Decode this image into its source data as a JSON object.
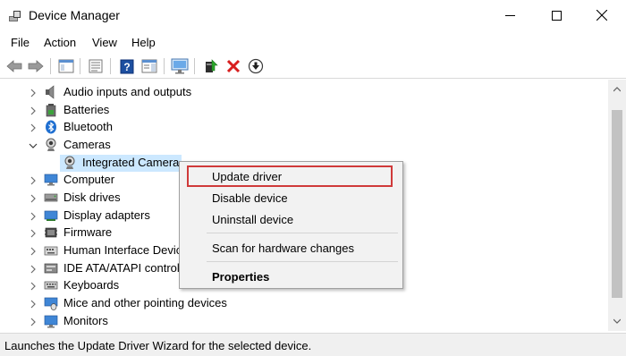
{
  "window": {
    "title": "Device Manager",
    "icon": "device-manager-icon",
    "controls": [
      "minimize-icon",
      "maximize-icon",
      "close-icon"
    ]
  },
  "menu": {
    "items": [
      {
        "label": "File"
      },
      {
        "label": "Action"
      },
      {
        "label": "View"
      },
      {
        "label": "Help"
      }
    ]
  },
  "toolbar": {
    "buttons": [
      {
        "icon": "back-arrow-icon"
      },
      {
        "icon": "forward-arrow-icon"
      },
      {
        "icon": "show-hide-console-tree-icon"
      },
      {
        "icon": "properties-icon"
      },
      {
        "icon": "help-icon"
      },
      {
        "icon": "action-pane-icon"
      },
      {
        "icon": "scan-hardware-icon"
      },
      {
        "icon": "update-driver-icon"
      },
      {
        "icon": "uninstall-icon"
      },
      {
        "icon": "disable-device-icon"
      }
    ]
  },
  "tree": {
    "items": [
      {
        "label": "Audio inputs and outputs",
        "icon": "speaker-icon",
        "expanded": false
      },
      {
        "label": "Batteries",
        "icon": "battery-icon",
        "expanded": false
      },
      {
        "label": "Bluetooth",
        "icon": "bluetooth-icon",
        "expanded": false
      },
      {
        "label": "Cameras",
        "icon": "camera-icon",
        "expanded": true
      },
      {
        "label": "Integrated Camera",
        "icon": "webcam-icon",
        "selected": true
      },
      {
        "label": "Computer",
        "icon": "computer-icon",
        "expanded": false
      },
      {
        "label": "Disk drives",
        "icon": "disk-drive-icon",
        "expanded": false
      },
      {
        "label": "Display adapters",
        "icon": "display-adapter-icon",
        "expanded": false
      },
      {
        "label": "Firmware",
        "icon": "firmware-icon",
        "expanded": false
      },
      {
        "label": "Human Interface Devic",
        "icon": "hid-icon",
        "expanded": false
      },
      {
        "label": "IDE ATA/ATAPI controlle",
        "icon": "ide-controller-icon",
        "expanded": false
      },
      {
        "label": "Keyboards",
        "icon": "keyboard-icon",
        "expanded": false
      },
      {
        "label": "Mice and other pointing devices",
        "icon": "mouse-icon",
        "expanded": false
      },
      {
        "label": "Monitors",
        "icon": "monitor-icon",
        "expanded": false
      }
    ]
  },
  "context_menu": {
    "items": [
      {
        "label": "Update driver",
        "highlighted": true
      },
      {
        "label": "Disable device"
      },
      {
        "label": "Uninstall device"
      },
      {
        "label": "Scan for hardware changes"
      },
      {
        "label": "Properties",
        "bold": true
      }
    ]
  },
  "status": {
    "text": "Launches the Update Driver Wizard for the selected device."
  },
  "colors": {
    "selection": "#cce8ff",
    "highlight_box": "#d03a3a",
    "menu_bg": "#f2f2f2",
    "statusbar_bg": "#f0f0f0"
  }
}
